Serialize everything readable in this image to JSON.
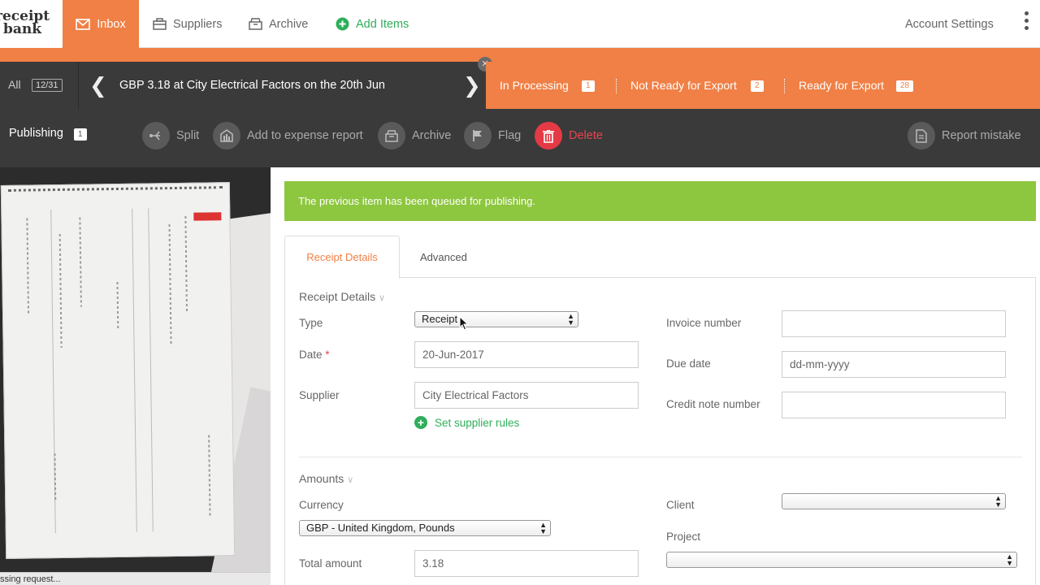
{
  "nav": {
    "logo_line1": "receipt",
    "logo_line2": "bank",
    "inbox": "Inbox",
    "suppliers": "Suppliers",
    "archive": "Archive",
    "add_items": "Add Items",
    "account_settings": "Account Settings",
    "accent_color": "#f08045"
  },
  "itembar": {
    "all_label": "All",
    "count": "12/31",
    "item_title": "GBP 3.18 at City Electrical Factors on the 20th Jun",
    "statuses": [
      {
        "label": "In Processing",
        "count": "1"
      },
      {
        "label": "Not Ready for Export",
        "count": "2"
      },
      {
        "label": "Ready for Export",
        "count": "28"
      }
    ]
  },
  "toolbar": {
    "publishing_label": "Publishing",
    "publishing_count": "1",
    "split": "Split",
    "add_expense": "Add to expense report",
    "archive": "Archive",
    "flag": "Flag",
    "delete": "Delete",
    "report_mistake": "Report mistake"
  },
  "status_strip": "ssing request...",
  "alert": {
    "message": "The previous item has been queued for publishing.",
    "color": "#8dc63f"
  },
  "tabs": {
    "receipt_details": "Receipt Details",
    "advanced": "Advanced"
  },
  "receipt_details": {
    "section_title": "Receipt Details",
    "type_label": "Type",
    "type_value": "Receipt",
    "date_label": "Date",
    "date_required": "*",
    "date_value": "20-Jun-2017",
    "supplier_label": "Supplier",
    "supplier_value": "City Electrical Factors",
    "supplier_rules_link": "Set supplier rules",
    "invoice_label": "Invoice number",
    "invoice_value": "",
    "due_date_label": "Due date",
    "due_date_placeholder": "dd-mm-yyyy",
    "credit_note_label": "Credit note number",
    "credit_note_value": ""
  },
  "amounts": {
    "section_title": "Amounts",
    "currency_label": "Currency",
    "currency_value": "GBP - United Kingdom, Pounds",
    "total_label": "Total amount",
    "total_value": "3.18",
    "client_label": "Client",
    "client_value": "",
    "project_label": "Project",
    "project_value": ""
  }
}
